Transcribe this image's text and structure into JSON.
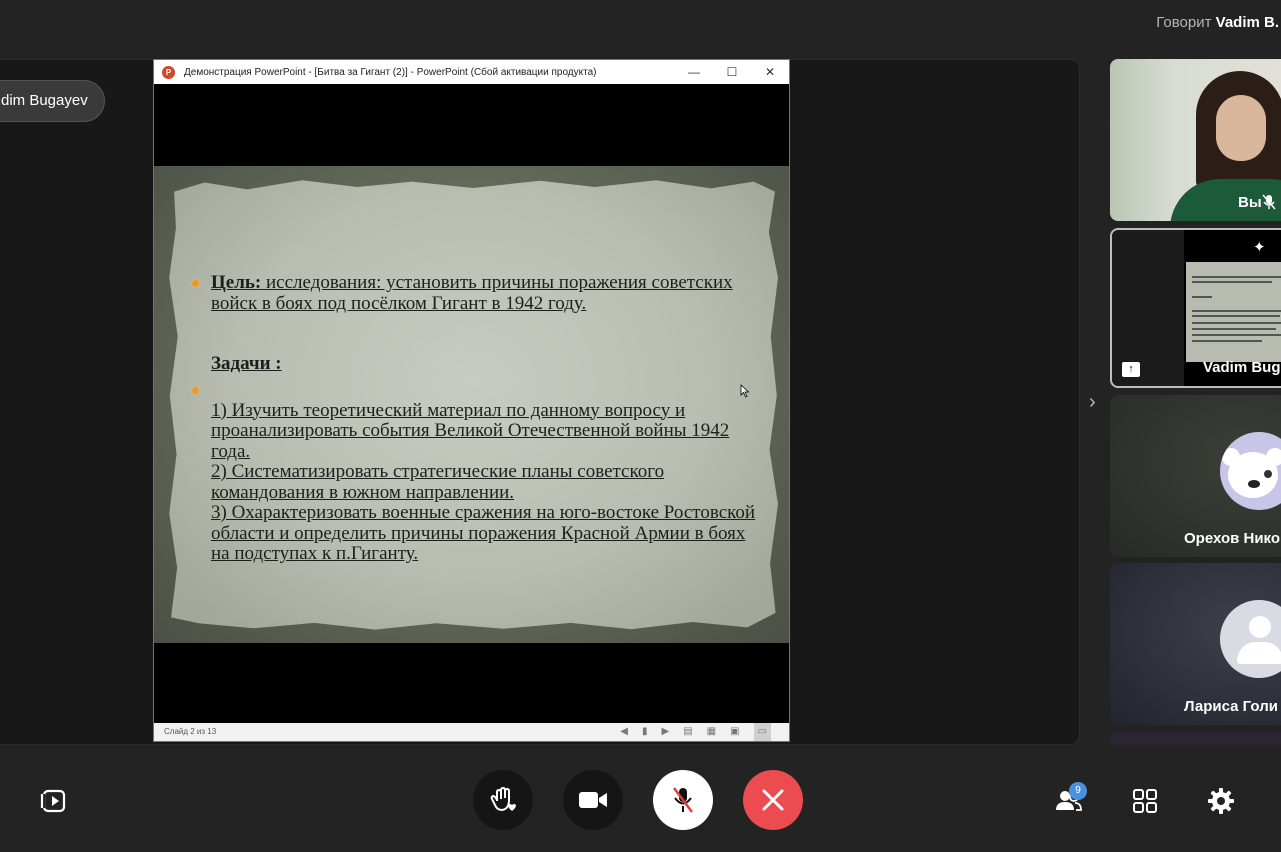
{
  "header": {
    "speaking_prefix": "Говорит",
    "speaking_name": "Vadim B."
  },
  "stage": {
    "presenter_chip": "dim Bugayev",
    "expand_icon": "chevron-right-icon"
  },
  "ppt_window": {
    "title": "Демонстрация PowerPoint - [Битва за Гигант (2)] - PowerPoint (Сбой активации продукта)",
    "logo": "P",
    "minimize": "—",
    "maximize": "☐",
    "close": "✕",
    "status": "Слайд 2 из 13"
  },
  "slide": {
    "goal_label": "Цель:",
    "goal_text": " исследования:  установить  причины поражения советских войск в боях под посёлком Гигант в 1942 году.",
    "tasks_heading": "Задачи :",
    "task_1": "1) Изучить теоретический материал по данному вопросу и проанализировать события Великой Отечественной войны 1942 года.",
    "task_2": "2) Систематизировать стратегические планы советского командования в южном направлении.",
    "task_3": "3) Охарактеризовать военные сражения на юго-востоке Ростовской области и определить причины поражения Красной Армии в боях на подступах к п.Гиганту."
  },
  "participants": [
    {
      "label": "Вы",
      "icon": "mic-off-icon"
    },
    {
      "label": "Vadim Bug",
      "icon": "pin-icon"
    },
    {
      "label": "Орехов Нико",
      "icon": "bear-avatar"
    },
    {
      "label": "Лариса Голи",
      "icon": "person-avatar"
    }
  ],
  "controls": {
    "participants_count": "9",
    "share_icon": "screen-share-icon",
    "hand_icon": "raise-hand-icon",
    "camera_icon": "camera-icon",
    "mic_icon": "mic-off-icon",
    "end_icon": "close-icon",
    "people_icon": "participants-icon",
    "grid_icon": "grid-icon",
    "settings_icon": "gear-icon"
  },
  "colors": {
    "background": "#232323",
    "end_call": "#ec4c4f",
    "badge": "#4a90e2",
    "ppt_border": "#c9572c"
  }
}
